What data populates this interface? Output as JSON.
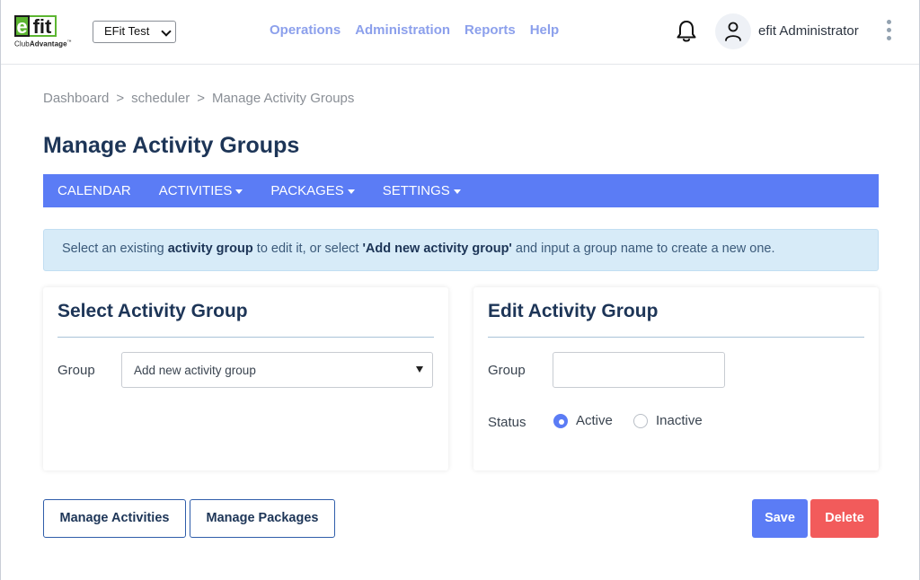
{
  "brand": {
    "logo_e": "e",
    "logo_fit": "fit",
    "logo_text_light": "Club",
    "logo_text_bold": "Advantage",
    "logo_tm": "™",
    "green": "#5cb531"
  },
  "site_select": {
    "value": "EFit Test"
  },
  "topnav": {
    "items": [
      "Operations",
      "Administration",
      "Reports",
      "Help"
    ],
    "color": "#8ca0ec"
  },
  "user": {
    "name": "efit Administrator"
  },
  "breadcrumb": {
    "items": [
      "Dashboard",
      "scheduler",
      "Manage Activity Groups"
    ],
    "separator": ">"
  },
  "page_title": "Manage Activity Groups",
  "subnav": {
    "items": [
      {
        "label": "CALENDAR",
        "dropdown": false
      },
      {
        "label": "ACTIVITIES",
        "dropdown": true
      },
      {
        "label": "PACKAGES",
        "dropdown": true
      },
      {
        "label": "SETTINGS",
        "dropdown": true
      }
    ],
    "background": "#5b7cf5"
  },
  "alert": {
    "part1": "Select an existing ",
    "bold1": "activity group",
    "part2": " to edit it, or select ",
    "bold2": "'Add new activity group'",
    "part3": " and input a group name to create a new one."
  },
  "select_card": {
    "title": "Select Activity Group",
    "group_label": "Group",
    "group_value": "Add new activity group"
  },
  "edit_card": {
    "title": "Edit Activity Group",
    "group_label": "Group",
    "group_value": "",
    "status_label": "Status",
    "active_label": "Active",
    "inactive_label": "Inactive",
    "selected_status": "Active"
  },
  "buttons": {
    "manage_activities": "Manage Activities",
    "manage_packages": "Manage Packages",
    "save": "Save",
    "delete": "Delete",
    "save_color": "#5b7cf5",
    "delete_color": "#f25b5b"
  }
}
